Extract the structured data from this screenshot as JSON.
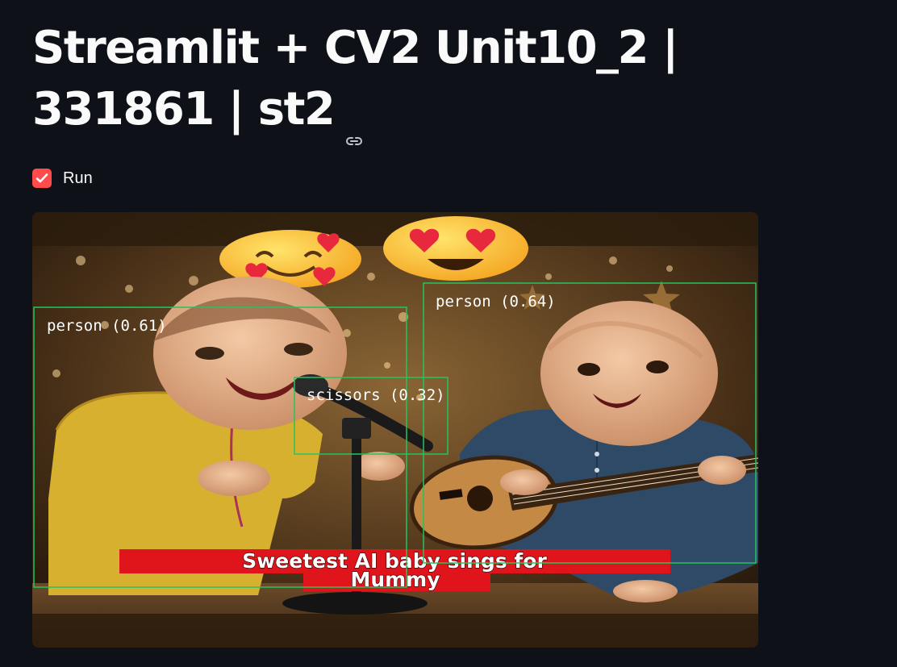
{
  "page": {
    "title": "Streamlit + CV2 Unit10_2 | 331861 | st2",
    "link_icon": "link-icon"
  },
  "run_checkbox": {
    "label": "Run",
    "checked": true,
    "accent_color": "#ff4b4b"
  },
  "video": {
    "caption_line1": "Sweetest AI baby sings for",
    "caption_line2": "Mummy",
    "detections": [
      {
        "label": "person (0.61)"
      },
      {
        "label": "person (0.64)"
      },
      {
        "label": "scissors (0.32)"
      }
    ],
    "box_color": "#22c55e"
  }
}
